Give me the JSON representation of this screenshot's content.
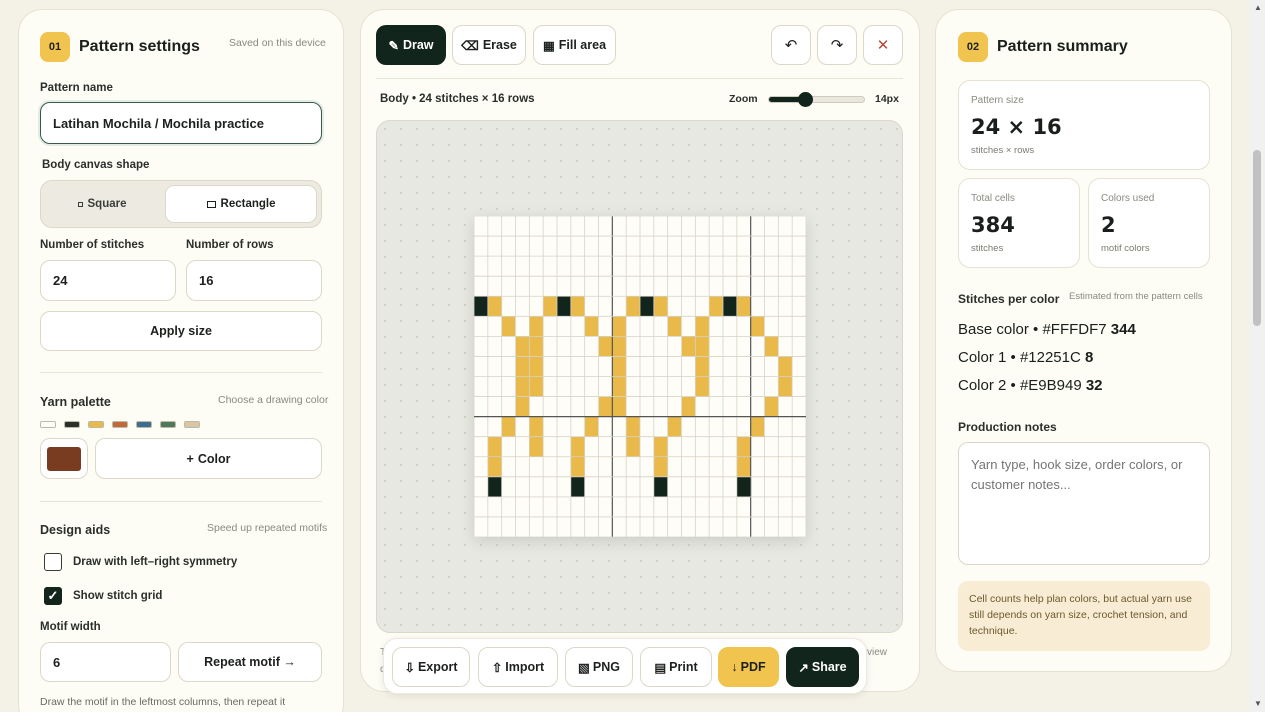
{
  "settings": {
    "step": "01",
    "title": "Pattern settings",
    "saved_note": "Saved on this device",
    "pattern_name_label": "Pattern name",
    "pattern_name_value": "Latihan Mochila / Mochila practice",
    "canvas_shape_label": "Body canvas shape",
    "shape_square": "Square",
    "shape_rectangle": "Rectangle",
    "stitches_label": "Number of stitches",
    "stitches_value": "24",
    "rows_label": "Number of rows",
    "rows_value": "16",
    "apply_size": "Apply size",
    "yarn_palette_label": "Yarn palette",
    "yarn_palette_hint": "Choose a drawing color",
    "palette_swatches": [
      "#FFFDF7",
      "#2B2F2C",
      "#E9B949",
      "#C2683A",
      "#3C6E8F",
      "#4F7A5A",
      "#D9C6A4"
    ],
    "current_color": "#7A3C20",
    "add_color": "Color",
    "design_aids_label": "Design aids",
    "design_aids_hint": "Speed up repeated motifs",
    "symmetry_label": "Draw with left–right symmetry",
    "symmetry_checked": false,
    "grid_label": "Show stitch grid",
    "grid_checked": true,
    "motif_width_label": "Motif width",
    "motif_width_value": "6",
    "repeat_motif": "Repeat motif →",
    "motif_help": "Draw the motif in the leftmost columns, then repeat it"
  },
  "toolbar": {
    "draw": "Draw",
    "erase": "Erase",
    "fill": "Fill area",
    "undo_icon": "undo-icon",
    "redo_icon": "redo-icon",
    "clear_icon": "close-icon"
  },
  "canvas": {
    "info": "Body • 24 stitches × 16 rows",
    "zoom_label": "Zoom",
    "zoom_value": "14px",
    "zoom_level": 0.38,
    "cols": 24,
    "rows": 16,
    "base_color": "#FFFDF7",
    "color1": "#12251C",
    "color2": "#E9B949",
    "cells_color1": [
      [
        4,
        0
      ],
      [
        4,
        6
      ],
      [
        4,
        12
      ],
      [
        4,
        18
      ],
      [
        13,
        1
      ],
      [
        13,
        7
      ],
      [
        13,
        13
      ],
      [
        13,
        19
      ]
    ],
    "cells_color2": [
      [
        4,
        1
      ],
      [
        5,
        2
      ],
      [
        6,
        3
      ],
      [
        7,
        4
      ],
      [
        8,
        4
      ],
      [
        9,
        3
      ],
      [
        10,
        2
      ],
      [
        11,
        1
      ],
      [
        12,
        1
      ],
      [
        4,
        5
      ],
      [
        5,
        4
      ],
      [
        6,
        4
      ],
      [
        7,
        3
      ],
      [
        8,
        3
      ],
      [
        9,
        3
      ],
      [
        10,
        4
      ],
      [
        11,
        4
      ],
      [
        4,
        7
      ],
      [
        5,
        8
      ],
      [
        6,
        9
      ],
      [
        7,
        10
      ],
      [
        8,
        10
      ],
      [
        9,
        9
      ],
      [
        10,
        8
      ],
      [
        11,
        7
      ],
      [
        12,
        7
      ],
      [
        4,
        11
      ],
      [
        5,
        10
      ],
      [
        6,
        10
      ],
      [
        7,
        10
      ],
      [
        8,
        10
      ],
      [
        9,
        10
      ],
      [
        10,
        11
      ],
      [
        11,
        11
      ],
      [
        4,
        13
      ],
      [
        5,
        14
      ],
      [
        6,
        15
      ],
      [
        7,
        16
      ],
      [
        8,
        16
      ],
      [
        9,
        15
      ],
      [
        10,
        14
      ],
      [
        11,
        13
      ],
      [
        12,
        13
      ],
      [
        4,
        17
      ],
      [
        5,
        16
      ],
      [
        6,
        16
      ],
      [
        4,
        19
      ],
      [
        5,
        20
      ],
      [
        6,
        21
      ],
      [
        7,
        22
      ],
      [
        8,
        22
      ],
      [
        9,
        21
      ],
      [
        10,
        20
      ],
      [
        11,
        19
      ],
      [
        12,
        19
      ]
    ]
  },
  "actions": {
    "export": "Export",
    "import": "Import",
    "png": "PNG",
    "print": "Print",
    "pdf": "PDF",
    "share": "Share",
    "behind_left": "T",
    "behind_left2": "c",
    "behind_right": "view"
  },
  "summary": {
    "step": "02",
    "title": "Pattern summary",
    "size_label": "Pattern size",
    "size_value": "24 × 16",
    "size_sub": "stitches × rows",
    "total_label": "Total cells",
    "total_value": "384",
    "total_sub": "stitches",
    "colors_label": "Colors used",
    "colors_value": "2",
    "colors_sub": "motif colors",
    "spc_label": "Stitches per color",
    "spc_hint": "Estimated from the pattern cells",
    "spc_rows": [
      {
        "name": "Base color • #FFFDF7",
        "count": "344"
      },
      {
        "name": "Color 1 • #12251C",
        "count": "8"
      },
      {
        "name": "Color 2 • #E9B949",
        "count": "32"
      }
    ],
    "notes_label": "Production notes",
    "notes_placeholder": "Yarn type, hook size, order colors, or customer notes...",
    "tip": "Cell counts help plan colors, but actual yarn use still depends on yarn size, crochet tension, and technique."
  }
}
